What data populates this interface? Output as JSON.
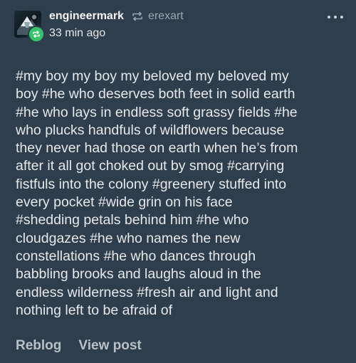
{
  "post": {
    "username": "engineermark",
    "source": "erexart",
    "time": "33 min ago",
    "lines": [
      "#my boy my boy my beloved my beloved my",
      "boy  #he who deserves both feet in solid earth",
      "#he who lays in endless soft grassy fields  #he",
      "who plucks handfuls of wildflowers because",
      "they never had those on earth when he’s from",
      "after it all got choked out by smog  #carrying",
      "fistfuls into the colony  #greenery stuffed into",
      "every pocket  #wide grin on his face",
      "#shedding petals behind him  #he who",
      "cloudgazes  #he who names the new",
      "constellations  #he who dances through",
      "babbling brooks and laughs aloud in the",
      "endless wilderness  #fresh air and light and",
      "nothing left to be afraid of"
    ]
  },
  "footer": {
    "reblog_label": "Reblog",
    "view_post_label": "View post"
  },
  "icons": {
    "reblog": "reblog-icon",
    "badge": "reblog-badge-icon",
    "more": "more-options-icon"
  },
  "colors": {
    "background": "#2f3e4c",
    "badge": "#36c46a",
    "muted": "#9aa6b1"
  }
}
